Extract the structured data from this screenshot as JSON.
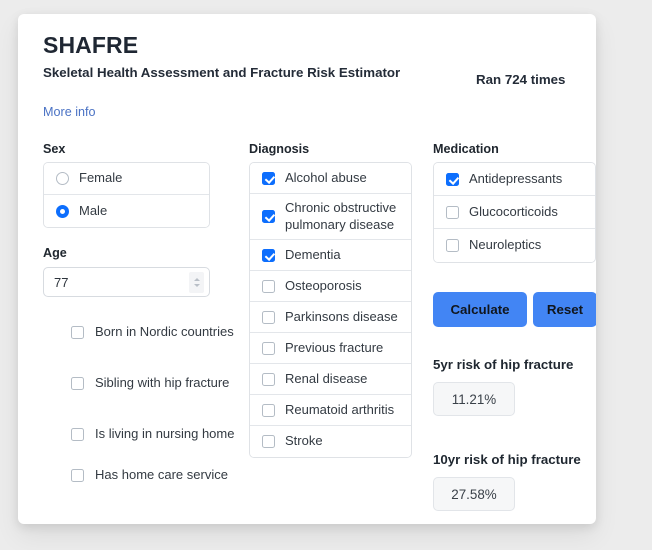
{
  "header": {
    "title": "SHAFRE",
    "subtitle": "Skeletal Health Assessment and Fracture Risk Estimator",
    "run_count_text": "Ran 724 times",
    "more_info_label": "More info"
  },
  "sex": {
    "title": "Sex",
    "options": [
      {
        "label": "Female",
        "selected": false
      },
      {
        "label": "Male",
        "selected": true
      }
    ]
  },
  "age": {
    "title": "Age",
    "value": "77",
    "placeholder": "Age"
  },
  "risk_factors": [
    {
      "label": "Born in Nordic countries",
      "checked": false
    },
    {
      "label": "Sibling with hip fracture",
      "checked": false
    },
    {
      "label": "Is living in nursing home",
      "checked": false
    },
    {
      "label": "Has home care service",
      "checked": false
    }
  ],
  "diagnosis": {
    "title": "Diagnosis",
    "items": [
      {
        "label": "Alcohol abuse",
        "checked": true
      },
      {
        "label": "Chronic obstructive pulmonary disease",
        "checked": true
      },
      {
        "label": "Dementia",
        "checked": true
      },
      {
        "label": "Osteoporosis",
        "checked": false
      },
      {
        "label": "Parkinsons disease",
        "checked": false
      },
      {
        "label": "Previous fracture",
        "checked": false
      },
      {
        "label": "Renal disease",
        "checked": false
      },
      {
        "label": "Reumatoid arthritis",
        "checked": false
      },
      {
        "label": "Stroke",
        "checked": false
      }
    ]
  },
  "medication": {
    "title": "Medication",
    "items": [
      {
        "label": "Antidepressants",
        "checked": true
      },
      {
        "label": "Glucocorticoids",
        "checked": false
      },
      {
        "label": "Neuroleptics",
        "checked": false
      }
    ]
  },
  "actions": {
    "calculate_label": "Calculate",
    "reset_label": "Reset"
  },
  "results": [
    {
      "label": "5yr risk of hip fracture",
      "value": "11.21%"
    },
    {
      "label": "10yr risk of hip fracture",
      "value": "27.58%"
    }
  ],
  "colors": {
    "accent": "#0d6efd",
    "button": "#4285f4",
    "link": "#4a72c4",
    "page_background": "#ececec",
    "card_background": "#ffffff",
    "result_background": "#f6f7f8"
  }
}
